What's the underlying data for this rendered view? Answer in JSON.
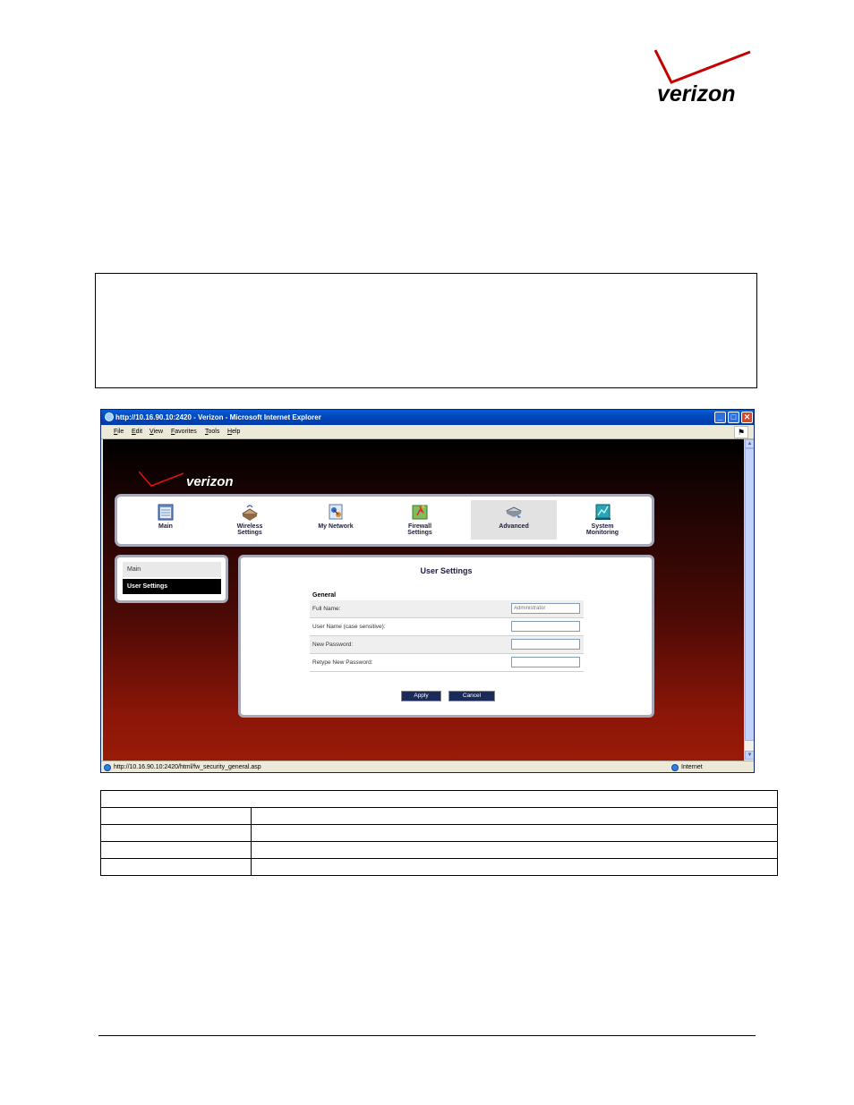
{
  "page": {
    "logo_text": "verizon"
  },
  "browser": {
    "title": "http://10.16.90.10:2420 - Verizon - Microsoft Internet Explorer",
    "controls": {
      "minimize": "_",
      "maximize": "□",
      "close": "✕"
    },
    "menu": [
      "File",
      "Edit",
      "View",
      "Favorites",
      "Tools",
      "Help"
    ],
    "status_url": "http://10.16.90.10:2420/html/fw_security_general.asp",
    "status_zone": "Internet"
  },
  "app": {
    "logo_text": "verizon",
    "nav": [
      {
        "label_line1": "Main",
        "label_line2": "",
        "icon": "main-icon",
        "active": false
      },
      {
        "label_line1": "Wireless",
        "label_line2": "Settings",
        "icon": "wireless-icon",
        "active": false
      },
      {
        "label_line1": "My Network",
        "label_line2": "",
        "icon": "network-icon",
        "active": false
      },
      {
        "label_line1": "Firewall",
        "label_line2": "Settings",
        "icon": "firewall-icon",
        "active": false
      },
      {
        "label_line1": "Advanced",
        "label_line2": "",
        "icon": "advanced-icon",
        "active": true
      },
      {
        "label_line1": "System",
        "label_line2": "Monitoring",
        "icon": "monitor-icon",
        "active": false
      }
    ],
    "sidebar": [
      {
        "label": "Main",
        "selected": false
      },
      {
        "label": "User Settings",
        "selected": true
      }
    ],
    "content": {
      "title": "User Settings",
      "section": "General",
      "fields": [
        {
          "label": "Full Name:",
          "value": "",
          "placeholder": "Administrator"
        },
        {
          "label": "User Name  (case sensitive):",
          "value": "",
          "placeholder": ""
        },
        {
          "label": "New Password:",
          "value": "",
          "placeholder": ""
        },
        {
          "label": "Retype New Password:",
          "value": "",
          "placeholder": ""
        }
      ],
      "apply_label": "Apply",
      "cancel_label": "Cancel"
    },
    "colors": {
      "accent_red": "#cc0000",
      "panel_border": "#a9a9b7",
      "button_bg": "#1a2a5a"
    }
  }
}
